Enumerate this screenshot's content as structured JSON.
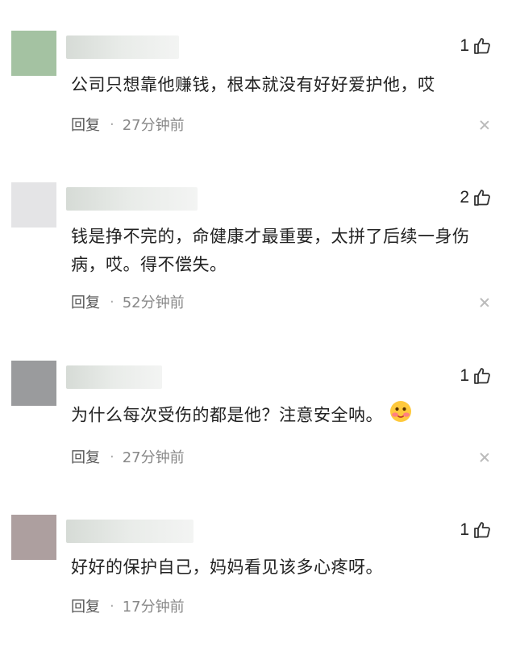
{
  "comments": [
    {
      "likes": "1",
      "text": "公司只想靠他赚钱，根本就没有好好爱护他，哎",
      "reply": "回复",
      "sep": "·",
      "time": "27分钟前",
      "avatar_color": "#a4c2a2",
      "has_emoji": false
    },
    {
      "likes": "2",
      "text": "钱是挣不完的，命健康才最重要，太拼了后续一身伤病，哎。得不偿失。",
      "reply": "回复",
      "sep": "·",
      "time": "52分钟前",
      "avatar_color": "#e4e4e6",
      "has_emoji": false
    },
    {
      "likes": "1",
      "text": "为什么每次受伤的都是他？注意安全呐。",
      "reply": "回复",
      "sep": "·",
      "time": "27分钟前",
      "avatar_color": "#9a9b9d",
      "has_emoji": true,
      "emoji": "flushed-face"
    },
    {
      "likes": "1",
      "text": "好好的保护自己，妈妈看见该多心疼呀。",
      "reply": "回复",
      "sep": "·",
      "time": "17分钟前",
      "avatar_color": "#ad9f9f",
      "has_emoji": false
    }
  ]
}
